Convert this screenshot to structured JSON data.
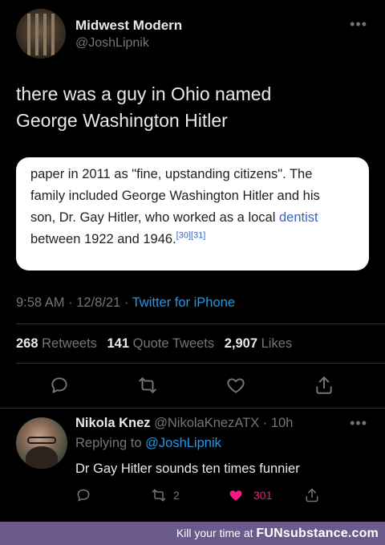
{
  "tweet": {
    "author_name": "Midwest Modern",
    "author_handle": "@JoshLipnik",
    "text_line1": "there was a guy in Ohio named",
    "text_line2": "George Washington Hitler",
    "quote": {
      "line1": "paper in 2011 as \"fine, upstanding citizens\". The",
      "line2": "family included George Washington Hitler and his",
      "line3_pre": "son, Dr. Gay Hitler, who worked as a local ",
      "line3_link": "dentist",
      "line4": "between 1922 and 1946.",
      "citations": "[30][31]"
    },
    "time": "9:58 AM · 12/8/21 · ",
    "source": "Twitter for iPhone",
    "stats": {
      "retweets_count": "268",
      "retweets_label": "Retweets",
      "quotes_count": "141",
      "quotes_label": "Quote Tweets",
      "likes_count": "2,907",
      "likes_label": "Likes"
    },
    "actions": [
      "reply-icon",
      "retweet-icon",
      "like-icon",
      "share-icon"
    ]
  },
  "reply": {
    "name": "Nikola Knez",
    "handle_time": "@NikolaKnezATX · 10h",
    "replying_label": "Replying to ",
    "replying_handle": "@JoshLipnik",
    "text": "Dr Gay Hitler sounds ten times funnier",
    "retweets": "2",
    "likes": "301"
  },
  "footer": {
    "tagline": "Kill your time at ",
    "brand": "FUNsubstance.com"
  },
  "colors": {
    "background": "#000000",
    "text": "#e7e9ea",
    "muted": "#71767b",
    "link": "#1d9bf0",
    "like_active": "#f91880",
    "footer_bg": "#6b5a8c"
  }
}
